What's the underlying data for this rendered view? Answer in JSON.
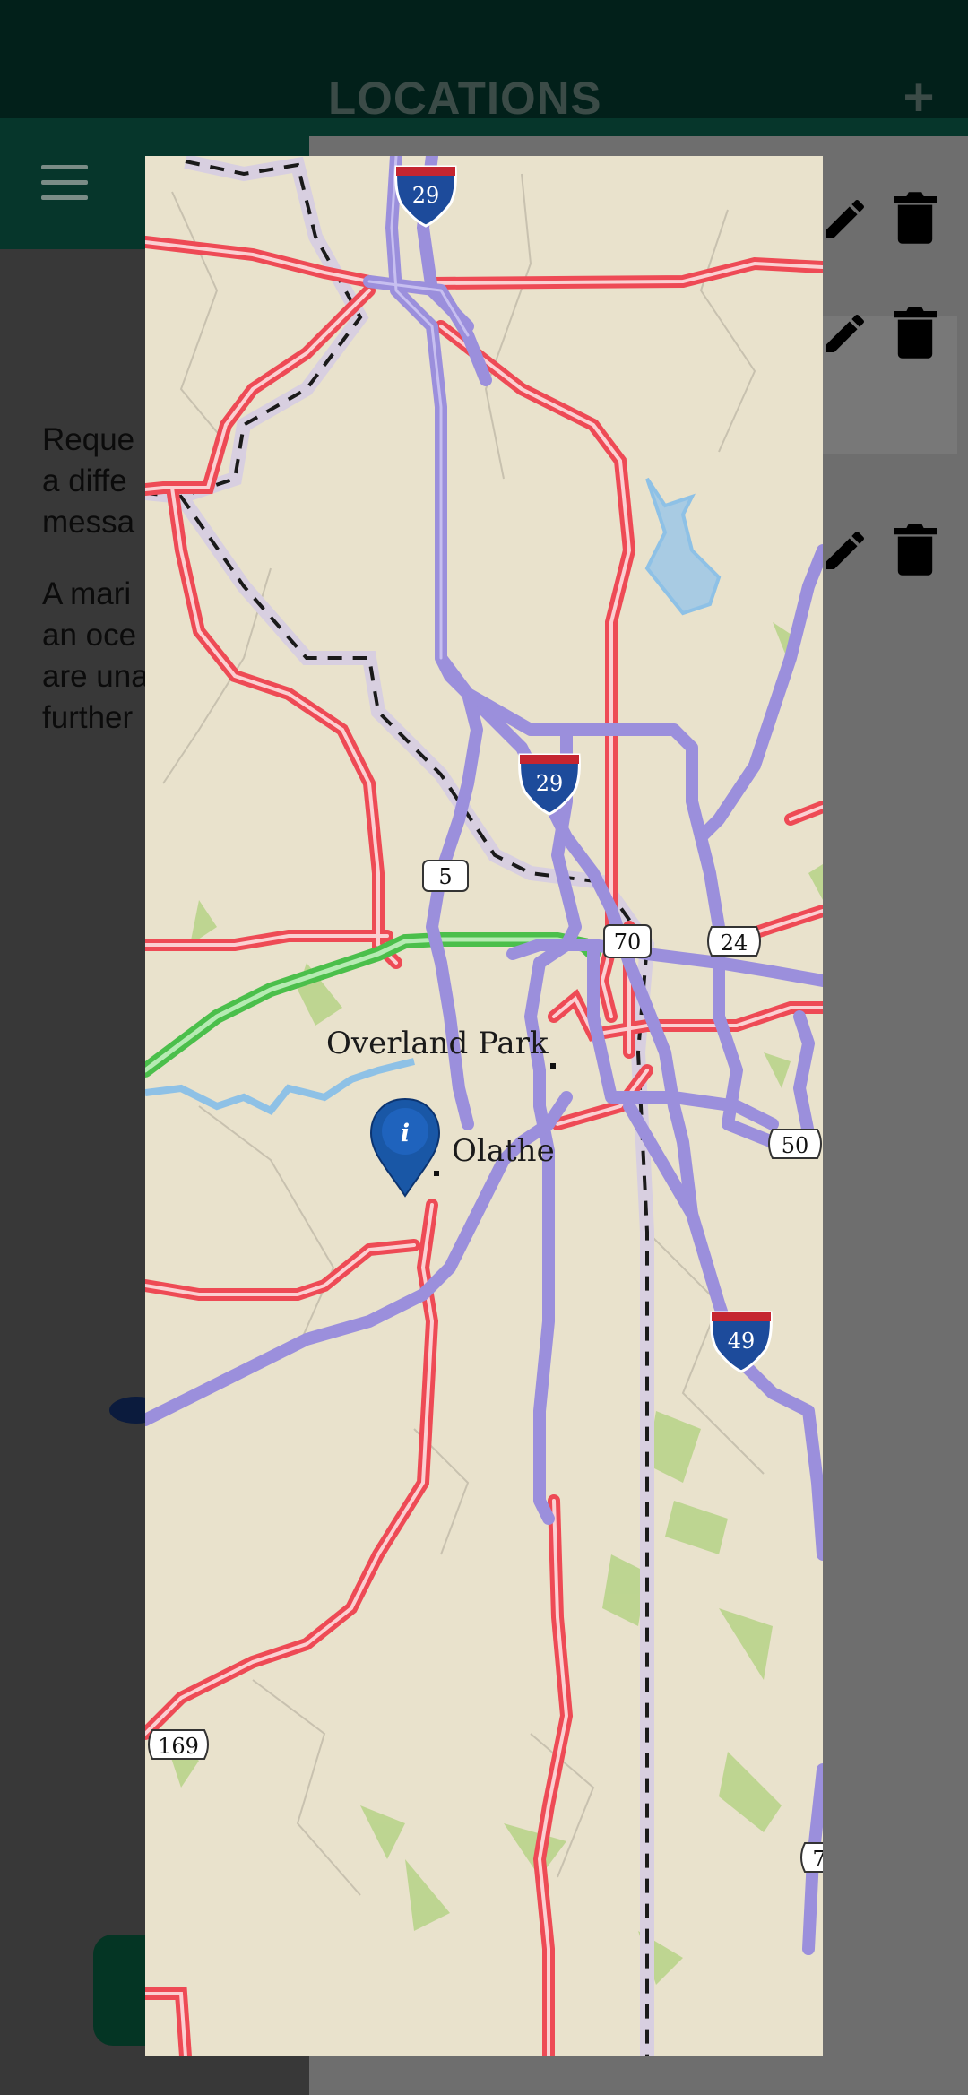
{
  "app": {
    "message_1": "Reque\na diffe\nmessa",
    "message_2": "A mari\nan oce\nare una\nfurther"
  },
  "drawer": {
    "title": "LOCATIONS",
    "add_label": "+",
    "rows": [
      {
        "selected": false
      },
      {
        "selected": true
      },
      {
        "selected": false
      }
    ]
  },
  "map": {
    "cities": [
      "Overland Park",
      "Olathe"
    ],
    "shields": {
      "interstate": [
        "29",
        "29",
        "49"
      ],
      "us": [
        "24",
        "50",
        "169",
        "7"
      ],
      "state": [
        "5",
        "70"
      ]
    },
    "marker": "i",
    "colors": {
      "land": "#e9e2cc",
      "interstate": "#9b8fdc",
      "highway": "#ee4a55",
      "toll": "#5bc85b",
      "water": "#8ec1e6"
    }
  }
}
